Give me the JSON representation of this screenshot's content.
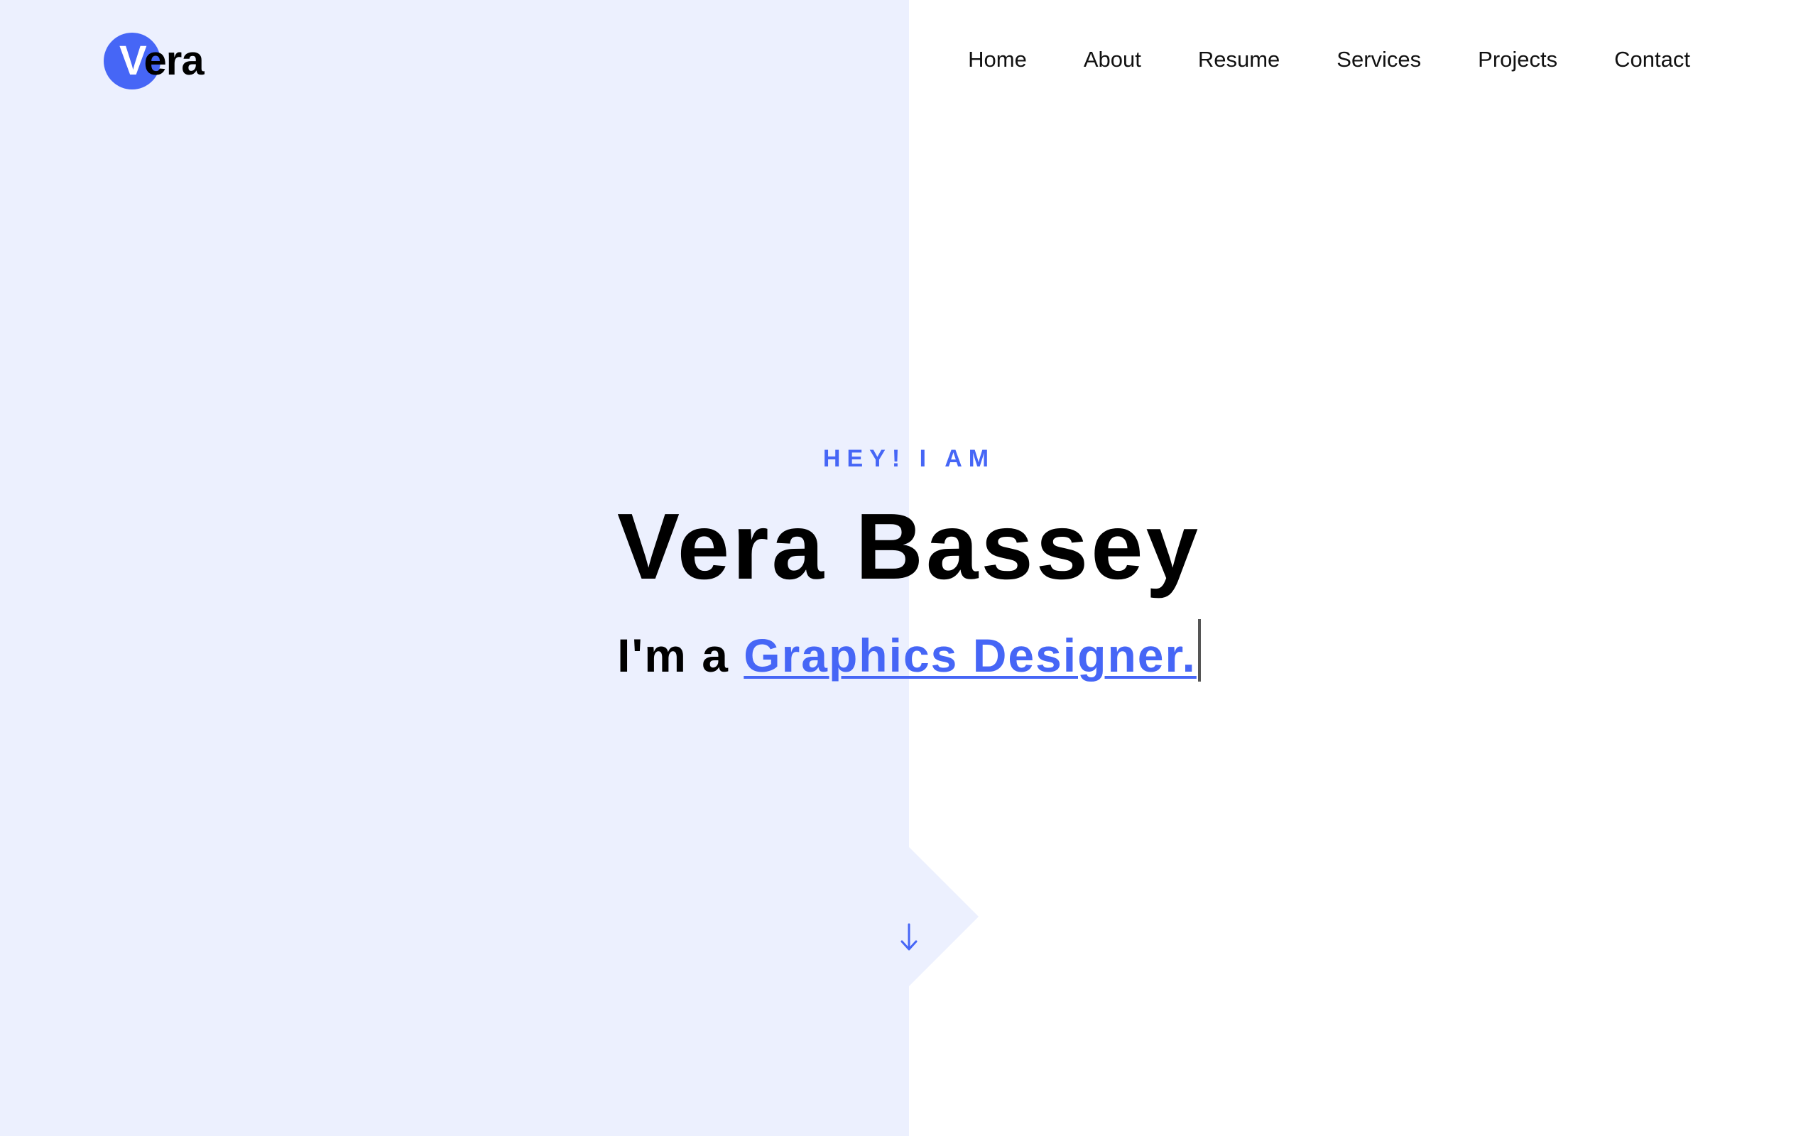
{
  "brand": {
    "logo_initial": "V",
    "logo_rest": "era",
    "accent_color": "#4666F6",
    "panel_color": "#ECF0FE"
  },
  "nav": {
    "items": [
      {
        "label": "Home"
      },
      {
        "label": "About"
      },
      {
        "label": "Resume"
      },
      {
        "label": "Services"
      },
      {
        "label": "Projects"
      },
      {
        "label": "Contact"
      }
    ]
  },
  "hero": {
    "eyebrow": "HEY! I AM",
    "name": "Vera Bassey",
    "role_prefix": "I'm a ",
    "role_highlight": "Graphics Designer.",
    "scroll_icon": "arrow-down-icon"
  }
}
